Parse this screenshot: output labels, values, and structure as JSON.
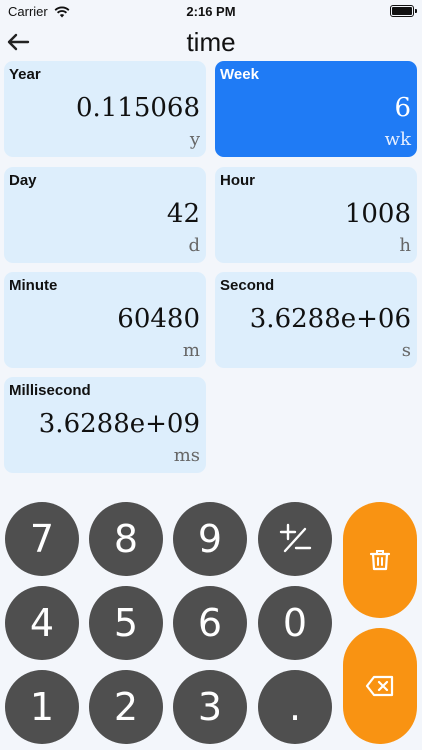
{
  "status": {
    "carrier": "Carrier",
    "time": "2:16 PM"
  },
  "nav": {
    "title": "time"
  },
  "units": [
    {
      "label": "Year",
      "value": "0.115068",
      "abbr": "y",
      "active": false
    },
    {
      "label": "Week",
      "value": "6",
      "abbr": "wk",
      "active": true
    },
    {
      "label": "Day",
      "value": "42",
      "abbr": "d",
      "active": false
    },
    {
      "label": "Hour",
      "value": "1008",
      "abbr": "h",
      "active": false
    },
    {
      "label": "Minute",
      "value": "60480",
      "abbr": "m",
      "active": false
    },
    {
      "label": "Second",
      "value": "3.6288e+06",
      "abbr": "s",
      "active": false
    },
    {
      "label": "Millisecond",
      "value": "3.6288e+09",
      "abbr": "ms",
      "active": false
    }
  ],
  "keypad": {
    "keys": [
      "7",
      "8",
      "9",
      "4",
      "5",
      "6",
      "0",
      "1",
      "2",
      "3",
      "."
    ],
    "clear_icon": "trash-icon",
    "backspace_icon": "backspace-icon"
  },
  "colors": {
    "active": "#1f7bf5",
    "card": "#ddeefc",
    "key": "#4f4f4f",
    "action": "#f99312"
  }
}
